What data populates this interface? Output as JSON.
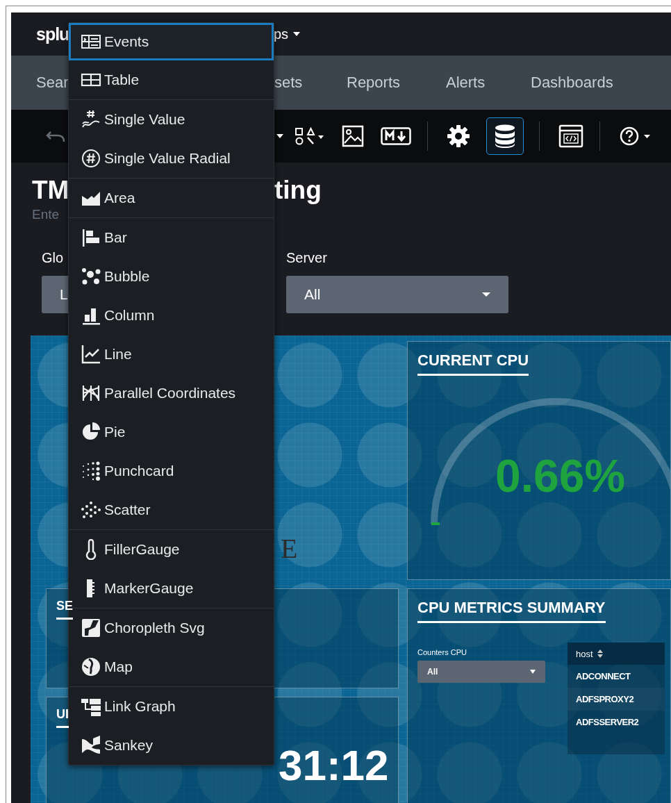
{
  "top_bar": {
    "logo": "splu",
    "apps_menu": "ps"
  },
  "nav": [
    {
      "label": "Sear"
    },
    {
      "label": "sets"
    },
    {
      "label": "Reports"
    },
    {
      "label": "Alerts"
    },
    {
      "label": "Dashboards"
    }
  ],
  "toolbar": [
    [
      {
        "kind": "undo",
        "selected": false
      },
      {
        "kind": "caret",
        "selected": false
      },
      {
        "kind": "shapes",
        "selected": false
      },
      {
        "kind": "image",
        "selected": false
      },
      {
        "kind": "markdown",
        "selected": false
      }
    ],
    [
      {
        "kind": "gear",
        "selected": false
      },
      {
        "kind": "database",
        "selected": true
      }
    ],
    [
      {
        "kind": "code",
        "selected": false
      }
    ],
    [
      {
        "kind": "help",
        "selected": false
      }
    ]
  ],
  "dashboard": {
    "title_start": "TM",
    "title_end": "ting",
    "description": "Ente"
  },
  "inputs": [
    {
      "label": "Glo",
      "value": "L"
    },
    {
      "label": "Server",
      "value": "All"
    }
  ],
  "image_text": "E",
  "current_cpu": {
    "title": "CURRENT CPU",
    "value": "0.66%"
  },
  "panel_se": {
    "title": "SE"
  },
  "panel_ui": {
    "title": "UI",
    "value": "31:12"
  },
  "cpu_metrics": {
    "title": "CPU METRICS SUMMARY",
    "filter": {
      "label": "Counters CPU",
      "value": "All"
    },
    "table": {
      "columns": [
        "host"
      ],
      "rows": [
        [
          "ADCONNECT"
        ],
        [
          "ADFSPROXY2"
        ],
        [
          "ADFSSERVER2"
        ]
      ]
    }
  },
  "viz_menu": {
    "groups": [
      [
        {
          "label": "Events",
          "kind": "events",
          "selected": true
        },
        {
          "label": "Table",
          "kind": "table",
          "selected": false
        }
      ],
      [
        {
          "label": "Single Value",
          "kind": "single",
          "selected": false
        },
        {
          "label": "Single Value Radial",
          "kind": "radial",
          "selected": false
        }
      ],
      [
        {
          "label": "Area",
          "kind": "area",
          "selected": false
        }
      ],
      [
        {
          "label": "Bar",
          "kind": "bar",
          "selected": false
        },
        {
          "label": "Bubble",
          "kind": "bubble",
          "selected": false
        },
        {
          "label": "Column",
          "kind": "column",
          "selected": false
        },
        {
          "label": "Line",
          "kind": "line",
          "selected": false
        },
        {
          "label": "Parallel Coordinates",
          "kind": "parallel",
          "selected": false
        },
        {
          "label": "Pie",
          "kind": "pie",
          "selected": false
        },
        {
          "label": "Punchcard",
          "kind": "punchcard",
          "selected": false
        },
        {
          "label": "Scatter",
          "kind": "scatter",
          "selected": false
        }
      ],
      [
        {
          "label": "FillerGauge",
          "kind": "filler",
          "selected": false
        },
        {
          "label": "MarkerGauge",
          "kind": "marker",
          "selected": false
        }
      ],
      [
        {
          "label": "Choropleth Svg",
          "kind": "choropleth",
          "selected": false
        },
        {
          "label": "Map",
          "kind": "map",
          "selected": false
        }
      ],
      [
        {
          "label": "Link Graph",
          "kind": "linkgraph",
          "selected": false
        },
        {
          "label": "Sankey",
          "kind": "sankey",
          "selected": false
        }
      ]
    ]
  }
}
